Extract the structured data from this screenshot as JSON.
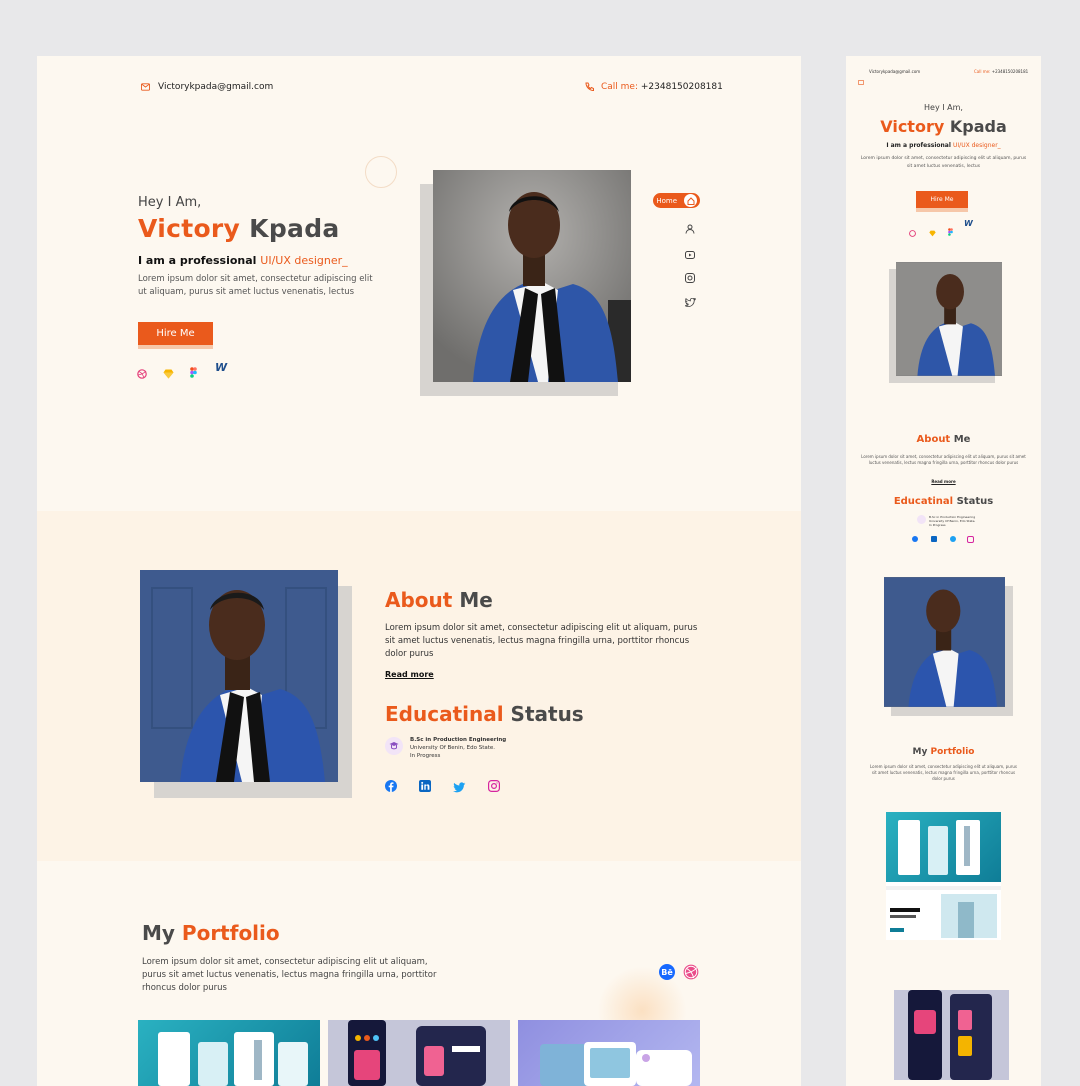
{
  "desktop": {
    "header": {
      "email": "Victorykpada@gmail.com",
      "call_label": "Call me:",
      "phone": "+2348150208181"
    },
    "hero": {
      "greeting": "Hey I Am,",
      "first_name": "Victory",
      "last_name": "Kpada",
      "role_prefix": "I am a professional",
      "role_highlight": "UI/UX designer_",
      "description": "Lorem ipsum dolor sit amet, consectetur adipiscing elit ut aliquam, purus sit amet luctus venenatis, lectus",
      "hire_button": "Hire Me",
      "tool_icons": [
        "dribbble-icon",
        "sketch-icon",
        "figma-icon",
        "webflow-icon"
      ],
      "webflow_letter": "W"
    },
    "side_nav": {
      "home_label": "Home",
      "icons": [
        "user-icon",
        "youtube-icon",
        "instagram-icon",
        "twitter-icon"
      ]
    },
    "about": {
      "title_a": "About",
      "title_b": "Me",
      "text": "Lorem ipsum dolor sit amet, consectetur adipiscing elit ut aliquam, purus sit amet luctus venenatis, lectus magna fringilla urna, porttitor rhoncus dolor purus",
      "read_more": "Read more"
    },
    "education": {
      "title_a": "Educatinal",
      "title_b": "Status",
      "degree": "B.Sc in Production Engineering",
      "school": "University Of Benin, Edo State.",
      "status": "In Progress"
    },
    "social_icons": [
      "facebook-icon",
      "linkedin-icon",
      "twitter-icon",
      "instagram-icon"
    ],
    "portfolio": {
      "title_a": "My",
      "title_b": "Portfolio",
      "text": "Lorem ipsum dolor sit amet, consectetur adipiscing elit ut aliquam, purus sit amet luctus venenatis, lectus magna fringilla urna, porttitor rhoncus dolor purus",
      "behance_label": "Bē"
    }
  },
  "mobile": {
    "email": "Victorykpada@gmail.com",
    "call_label": "Call me:",
    "phone": "+2348150208181",
    "greeting": "Hey I Am,",
    "first_name": "Victory",
    "last_name": "Kpada",
    "role_prefix": "I am a professional",
    "role_highlight": "UI/UX designer_",
    "description": "Lorem ipsum dolor sit amet, consectetur adipiscing elit ut aliquam, purus sit amet luctus venenatis, lectus",
    "hire_button": "Hire Me",
    "about_a": "About",
    "about_b": "Me",
    "about_text": "Lorem ipsum dolor sit amet, consectetur adipiscing elit ut aliquam, purus sit amet luctus venenatis, lectus magna fringilla urna, porttitor rhoncus dolor purus",
    "read_more": "Read more",
    "edu_a": "Educatinal",
    "edu_b": "Status",
    "edu_degree": "B.Sc in Production Engineering",
    "edu_school": "University Of Benin, Edo State.",
    "edu_status": "In Progress",
    "portfolio_a": "My",
    "portfolio_b": "Portfolio",
    "portfolio_text": "Lorem ipsum dolor sit amet, consectetur adipiscing elit ut aliquam, purus sit amet luctus venenatis, lectus magna fringilla urna, porttitor rhoncus dolor purus",
    "webflow_letter": "W"
  },
  "colors": {
    "accent": "#ea5a1c",
    "background": "#fdf8f0",
    "page": "#e8e8ea"
  }
}
